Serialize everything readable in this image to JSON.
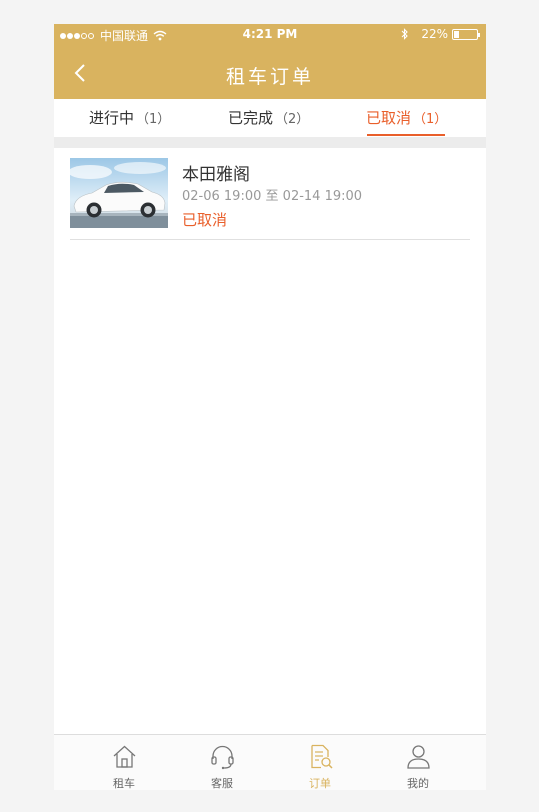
{
  "status_bar": {
    "carrier": "中国联通",
    "time": "4:21 PM",
    "battery": "22%",
    "battery_level": 0.22,
    "signal_filled": 3,
    "signal_total": 5
  },
  "header": {
    "title": "租车订单"
  },
  "tabs": [
    {
      "label": "进行中",
      "count": "（1）",
      "active": false
    },
    {
      "label": "已完成",
      "count": "（2）",
      "active": false
    },
    {
      "label": "已取消",
      "count": "（1）",
      "active": true
    }
  ],
  "orders": [
    {
      "car_name": "本田雅阁",
      "start": "02-06 19:00",
      "separator": "至",
      "end": "02-14 19:00",
      "status": "已取消",
      "thumbnail": "white-sedan-image"
    }
  ],
  "bottom_nav": [
    {
      "label": "租车",
      "icon": "home-icon",
      "active": false
    },
    {
      "label": "客服",
      "icon": "headset-icon",
      "active": false
    },
    {
      "label": "订单",
      "icon": "order-document-icon",
      "active": true
    },
    {
      "label": "我的",
      "icon": "user-icon",
      "active": false
    }
  ],
  "colors": {
    "brand_gold": "#d9b35f",
    "accent_orange": "#e95f2b",
    "text_dark": "#333333",
    "text_muted": "#999999"
  }
}
